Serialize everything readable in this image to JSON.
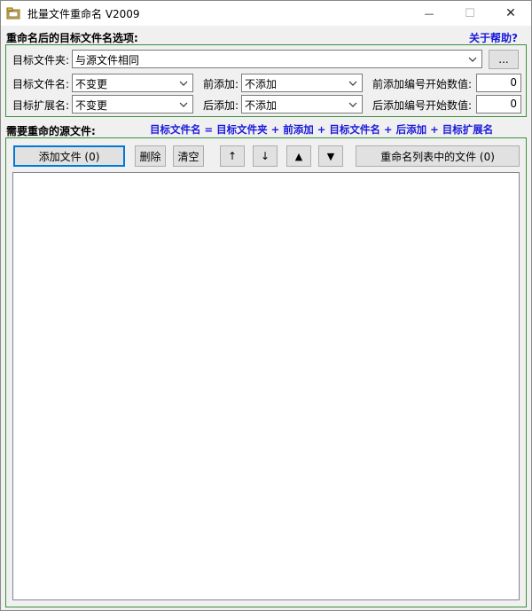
{
  "window": {
    "title": "批量文件重命名 V2009",
    "controls": {
      "minimize": "—",
      "maximize": "☐",
      "close": "✕"
    }
  },
  "options": {
    "section_title": "重命名后的目标文件名选项:",
    "help_link": "关于帮助?",
    "target_folder_label": "目标文件夹:",
    "target_folder_value": "与源文件相同",
    "browse_label": "...",
    "target_name_label": "目标文件名:",
    "target_name_value": "不变更",
    "target_ext_label": "目标扩展名:",
    "target_ext_value": "不变更",
    "prefix_label": "前添加:",
    "prefix_value": "不添加",
    "suffix_label": "后添加:",
    "suffix_value": "不添加",
    "prefix_start_label": "前添加编号开始数值:",
    "prefix_start_value": "0",
    "suffix_start_label": "后添加编号开始数值:",
    "suffix_start_value": "0"
  },
  "source": {
    "section_title": "需要重命的源文件:",
    "formula": "目标文件名 = 目标文件夹 +  前添加 + 目标文件名 + 后添加 + 目标扩展名",
    "add_files_label": "添加文件 (0)",
    "delete_label": "删除",
    "clear_label": "清空",
    "up_label": "↑",
    "down_label": "↓",
    "top_label": "▲",
    "bottom_label": "▼",
    "rename_label": "重命名列表中的文件 (0)"
  },
  "colors": {
    "accent_border": "#3b8f3b",
    "link_blue": "#1a1adb",
    "focus_blue": "#0078d7"
  }
}
